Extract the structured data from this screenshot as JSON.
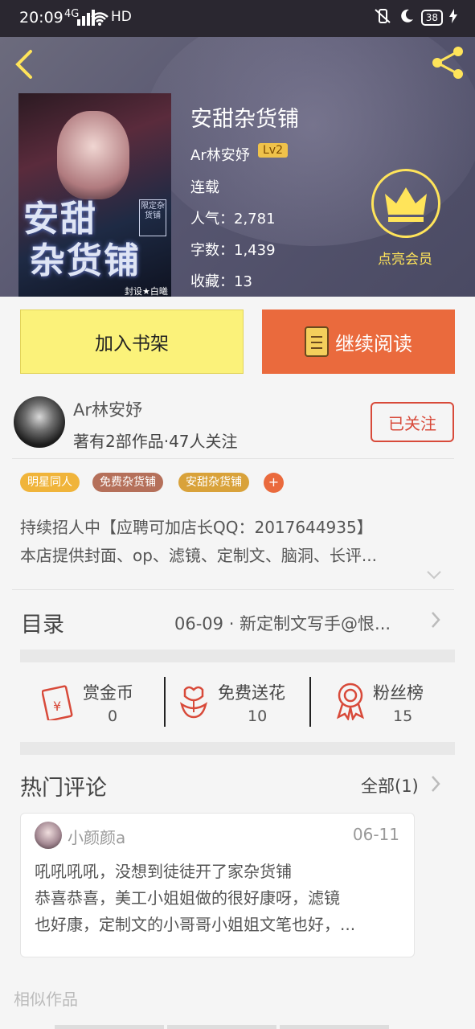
{
  "status_bar": {
    "time": "20:09",
    "network": "4G",
    "hd": "HD",
    "battery": "38"
  },
  "header": {
    "book_title": "安甜杂货铺",
    "author": "Ar林安妤",
    "level": "Lv2",
    "status": "连载",
    "popularity": "人气：2,781",
    "word_count": "字数：1,439",
    "favorites": "收藏：13",
    "vip_label": "点亮会员",
    "cover": {
      "title_line1": "安甜",
      "title_line2": "杂货铺",
      "stamp": "限定杂货铺",
      "credit": "封设★白曦"
    }
  },
  "actions": {
    "add_shelf": "加入书架",
    "continue_reading": "继续阅读"
  },
  "author_card": {
    "name": "Ar林安妤",
    "info": "著有2部作品·47人关注",
    "follow_label": "已关注"
  },
  "tags": [
    {
      "label": "明星同人",
      "color": "#f0b43a"
    },
    {
      "label": "免费杂货铺",
      "color": "#b5705a"
    },
    {
      "label": "安甜杂货铺",
      "color": "#d9a23a"
    }
  ],
  "tag_add": "+",
  "description": {
    "line1": "持续招人中【应聘可加店长QQ：2017644935】",
    "line2": "本店提供封面、op、滤镜、定制文、脑洞、长评..."
  },
  "toc": {
    "label": "目录",
    "latest": "06-09 · 新定制文写手@恨..."
  },
  "stats": [
    {
      "label": "赏金币",
      "value": "0",
      "icon": "red-envelope-icon"
    },
    {
      "label": "免费送花",
      "value": "10",
      "icon": "flower-icon"
    },
    {
      "label": "粉丝榜",
      "value": "15",
      "icon": "medal-icon"
    }
  ],
  "comments": {
    "title": "热门评论",
    "all_label": "全部(1)",
    "items": [
      {
        "user": "小颜颜a",
        "date": "06-11",
        "line1": "吼吼吼吼，没想到徒徒开了家杂货铺",
        "line2": "恭喜恭喜，美工小姐姐做的很好康呀，滤镜",
        "line3": "也好康，定制文的小哥哥小姐姐文笔也好，..."
      }
    ]
  },
  "similar_label": "相似作品",
  "colors": {
    "accent_orange": "#ea6a3d",
    "shelf_yellow": "#fbf27a",
    "vip_gold": "#ffe45a",
    "follow_red": "#d84a3a"
  }
}
